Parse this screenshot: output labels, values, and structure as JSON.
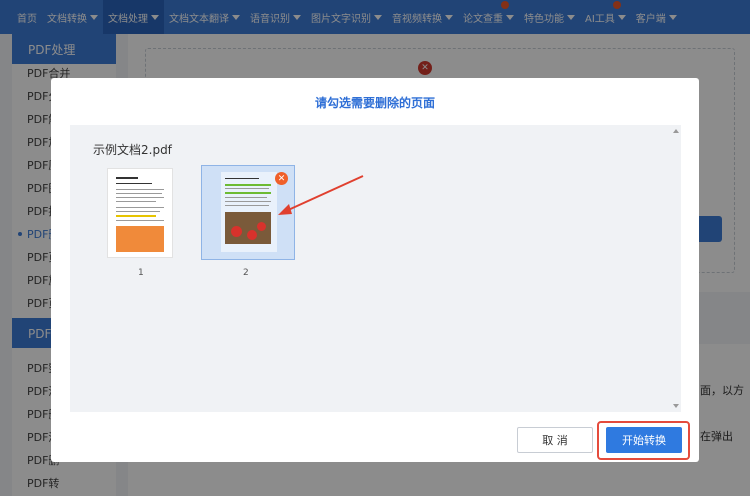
{
  "topnav": {
    "items": [
      {
        "label": "首页",
        "caret": false,
        "active": false
      },
      {
        "label": "文档转换",
        "caret": true,
        "active": false
      },
      {
        "label": "文档处理",
        "caret": true,
        "active": true
      },
      {
        "label": "文档文本翻译",
        "caret": true,
        "active": false
      },
      {
        "label": "语音识别",
        "caret": true,
        "active": false
      },
      {
        "label": "图片文字识别",
        "caret": true,
        "active": false
      },
      {
        "label": "音视频转换",
        "caret": true,
        "active": false
      },
      {
        "label": "论文查重",
        "caret": true,
        "active": false,
        "badge": true
      },
      {
        "label": "特色功能",
        "caret": true,
        "active": false
      },
      {
        "label": "AI工具",
        "caret": true,
        "active": false,
        "badge": true
      },
      {
        "label": "客户端",
        "caret": true,
        "active": false
      }
    ]
  },
  "sidebar": {
    "section1_title": "PDF处理",
    "section1_items": [
      "PDF合并",
      "PDF分",
      "PDF解",
      "PDF加",
      "PDF压",
      "PDF图",
      "PDF提",
      "PDF删",
      "PDF页",
      "PDF旋",
      "PDF页"
    ],
    "active_index": 7,
    "section2_title": "PDF编",
    "section2_items": [
      "PDF整",
      "PDF添",
      "PDF删",
      "PDF添",
      "PDF删",
      "PDF转"
    ]
  },
  "background": {
    "right_text_1": "面，以方",
    "right_text_2": "在弹出"
  },
  "modal": {
    "title": "请勾选需要删除的页面",
    "file_name": "示例文档2.pdf",
    "pages": [
      {
        "number": "1",
        "selected": false
      },
      {
        "number": "2",
        "selected": true
      }
    ],
    "cancel_label": "取 消",
    "start_label": "开始转换"
  },
  "colors": {
    "nav": "#3d7cd8",
    "accent": "#2f7ae0",
    "highlight_frame": "#e54b3c",
    "arrow": "#e0402f"
  }
}
